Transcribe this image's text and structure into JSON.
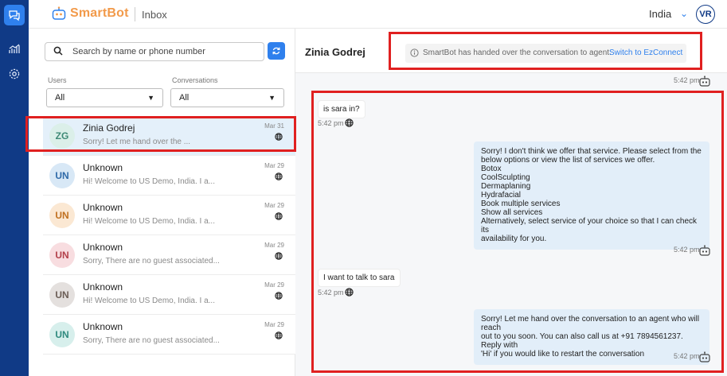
{
  "app": {
    "brand": "SmartBot",
    "section": "Inbox",
    "country": "India",
    "user_initials": "VR"
  },
  "sidebar": {
    "items": [
      {
        "icon": "chat-icon",
        "active": true
      },
      {
        "icon": "analytics-icon",
        "active": false
      },
      {
        "icon": "settings-icon",
        "active": false
      }
    ]
  },
  "search": {
    "placeholder": "Search by name or phone number",
    "value": ""
  },
  "filters": {
    "users": {
      "label": "Users",
      "value": "All"
    },
    "conversations": {
      "label": "Conversations",
      "value": "All"
    }
  },
  "conversations": [
    {
      "initials": "ZG",
      "name": "Zinia Godrej",
      "preview": "Sorry! Let me hand over the ...",
      "date": "Mar 31",
      "avatar_bg": "#dbefe9",
      "avatar_fg": "#3f8a76"
    },
    {
      "initials": "UN",
      "name": "Unknown",
      "preview": "Hi! Welcome to US Demo, India. I a...",
      "date": "Mar 29",
      "avatar_bg": "#d8e8f6",
      "avatar_fg": "#2f6aa8"
    },
    {
      "initials": "UN",
      "name": "Unknown",
      "preview": "Hi! Welcome to US Demo, India. I a...",
      "date": "Mar 29",
      "avatar_bg": "#fbe8d3",
      "avatar_fg": "#c07020"
    },
    {
      "initials": "UN",
      "name": "Unknown",
      "preview": "Sorry, There are no guest associated...",
      "date": "Mar 29",
      "avatar_bg": "#f8dde0",
      "avatar_fg": "#b3404a"
    },
    {
      "initials": "UN",
      "name": "Unknown",
      "preview": "Hi! Welcome to US Demo, India. I a...",
      "date": "Mar 29",
      "avatar_bg": "#e4e0de",
      "avatar_fg": "#6b5d55"
    },
    {
      "initials": "UN",
      "name": "Unknown",
      "preview": "Sorry, There are no guest associated...",
      "date": "Mar 29",
      "avatar_bg": "#d7efec",
      "avatar_fg": "#2f8a7e"
    }
  ],
  "chat": {
    "contact_name": "Zinia Godrej",
    "handover_notice": "SmartBot has handed over the conversation to agent.",
    "switch_label": "Switch to EzConnect",
    "top_time": "5:42 pm",
    "messages": [
      {
        "from": "user",
        "text": "is sara in?",
        "time": "5:42 pm"
      },
      {
        "from": "bot",
        "lines": [
          "Sorry! I don't think we offer that service. Please select from the",
          "below options or view the list of services we offer.",
          "Botox",
          "CoolSculpting",
          "Dermaplaning",
          "Hydrafacial",
          "Book multiple services",
          "Show all services",
          "Alternatively, select service of your choice so that I can check its",
          "availability for you."
        ],
        "time": "5:42 pm"
      },
      {
        "from": "user",
        "text": "I want to talk to sara",
        "time": "5:42 pm"
      },
      {
        "from": "bot",
        "lines": [
          "Sorry! Let me hand over the conversation to an agent who will reach",
          "out to you soon. You can also call us at +91 7894561237. Reply with",
          "'Hi' if you would like to restart the conversation"
        ],
        "time": "5:42 pm"
      }
    ]
  },
  "colors": {
    "rail": "#103a86",
    "accent": "#2f80ed",
    "brand": "#f29a4a",
    "highlight": "#e02020"
  }
}
